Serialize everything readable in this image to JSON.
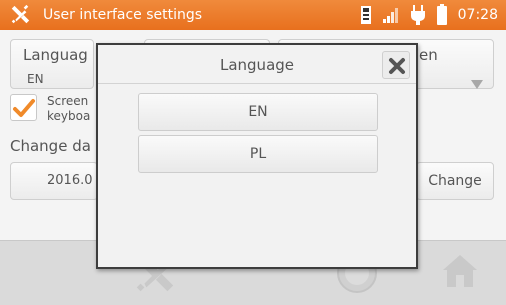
{
  "statusbar": {
    "title": "User interface settings",
    "time": "07:28",
    "icons": [
      "tools-icon",
      "memory-card-icon",
      "signal-icon",
      "power-plug-icon",
      "battery-icon"
    ]
  },
  "settings": {
    "language_label": "Languag",
    "language_value": "EN",
    "right_dropdown_label": "en",
    "screen_keyboard_label_line1": "Screen",
    "screen_keyboard_label_line2": "keyboa",
    "screen_keyboard_checked": true,
    "change_date_label": "Change da",
    "date_value": "2016.0",
    "change_button": "Change"
  },
  "modal": {
    "title": "Language",
    "options": [
      "EN",
      "PL"
    ]
  },
  "bottombar": {
    "icons": [
      "tools-icon",
      "help-icon",
      "home-icon"
    ]
  },
  "colors": {
    "accent": "#e8701e",
    "check": "#f08a2a"
  }
}
